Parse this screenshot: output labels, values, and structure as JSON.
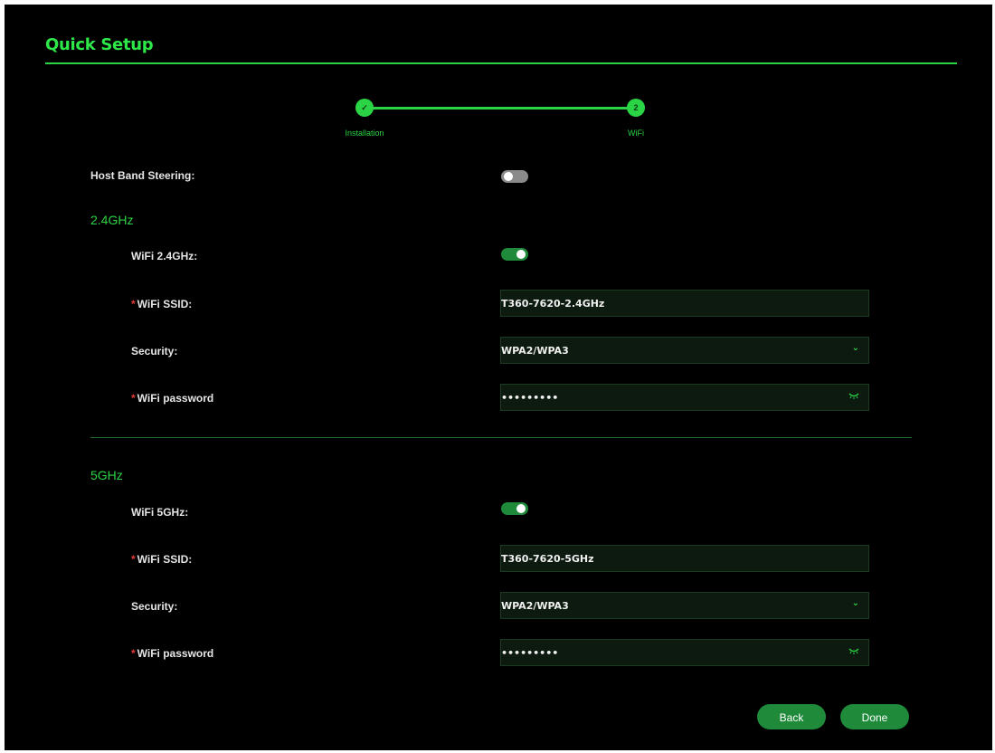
{
  "header": {
    "title": "Quick Setup"
  },
  "stepper": {
    "steps": [
      {
        "marker": "✓",
        "label": "Installation"
      },
      {
        "marker": "2",
        "label": "WiFi"
      }
    ]
  },
  "host_band_steering": {
    "label": "Host Band Steering:",
    "enabled": false
  },
  "band24": {
    "title": "2.4GHz",
    "wifi_label": "WiFi 2.4GHz:",
    "wifi_enabled": true,
    "ssid_required": "*",
    "ssid_label": "WiFi SSID:",
    "ssid_value": "T360-7620-2.4GHz",
    "security_label": "Security:",
    "security_value": "WPA2/WPA3",
    "password_required": "*",
    "password_label": "WiFi password",
    "password_value": "•••••••••"
  },
  "band5": {
    "title": "5GHz",
    "wifi_label": "WiFi 5GHz:",
    "wifi_enabled": true,
    "ssid_required": "*",
    "ssid_label": "WiFi SSID:",
    "ssid_value": "T360-7620-5GHz",
    "security_label": "Security:",
    "security_value": "WPA2/WPA3",
    "password_required": "*",
    "password_label": "WiFi password",
    "password_value": "•••••••••"
  },
  "icons": {
    "dropdown": "chevron-down-icon",
    "password": "eye-icon",
    "check": "check-icon"
  },
  "actions": {
    "back_label": "Back",
    "done_label": "Done"
  },
  "colors": {
    "accent": "#2bd444",
    "background": "#000000",
    "button": "#1f8a3a",
    "required": "#e33b3b"
  }
}
